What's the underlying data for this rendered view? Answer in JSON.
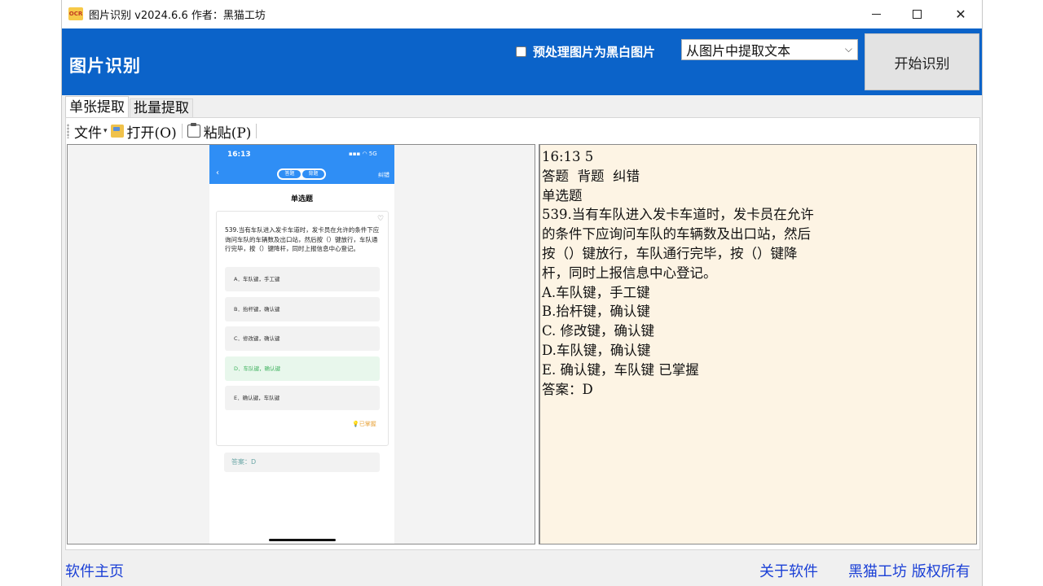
{
  "titlebar": {
    "icon_text": "OCR",
    "title": "图片识别 v2024.6.6    作者：黑猫工坊"
  },
  "header": {
    "title": "图片识别",
    "checkbox_label": "预处理图片为黑白图片",
    "checkbox_checked": false,
    "mode_select_value": "从图片中提取文本",
    "start_button": "开始识别"
  },
  "tabs": [
    {
      "label": "单张提取",
      "active": true
    },
    {
      "label": "批量提取",
      "active": false
    }
  ],
  "toolbar": {
    "file_label": "文件",
    "open_label": "打开(O)",
    "paste_label": "粘贴(P)"
  },
  "phone": {
    "time": "16:13",
    "status": "5G",
    "toggle_left": "答题",
    "toggle_right": "背题",
    "fix": "纠错",
    "heading": "单选题",
    "question": "539.当有车队进入发卡车道时，发卡员在允许的条件下应询问车队的车辆数及出口站，然后按（）键放行，车队通行完毕，按（）键降杆，同时上报信息中心登记。",
    "options": [
      {
        "text": "A．车队键，手工键",
        "correct": false
      },
      {
        "text": "B．抬杆键，确认键",
        "correct": false
      },
      {
        "text": "C．修改键，确认键",
        "correct": false
      },
      {
        "text": "D．车队键，确认键",
        "correct": true
      },
      {
        "text": "E．确认键，车队键",
        "correct": false
      }
    ],
    "mastered": "已掌握",
    "answer": "答案：D"
  },
  "ocr_result": "16:13 5\n答题  背题  纠错\n单选题\n539.当有车队进入发卡车道时，发卡员在允许\n的条件下应询问车队的车辆数及出口站，然后\n按（）键放行，车队通行完毕，按（）键降\n杆，同时上报信息中心登记。\nA.车队键，手工键\nB.抬杆键，确认键\nC. 修改键，确认键\nD.车队键，确认键\nE. 确认键，车队键 已掌握\n答案：D",
  "footer": {
    "home_link": "软件主页",
    "about_link": "关于软件",
    "copyright": "黑猫工坊 版权所有"
  },
  "colors": {
    "header_bg": "#0b63c9",
    "result_bg": "#fdf4e4",
    "link": "#1a3fd6",
    "phone_accent": "#2f8ef5",
    "correct_green": "#3fb25e"
  }
}
